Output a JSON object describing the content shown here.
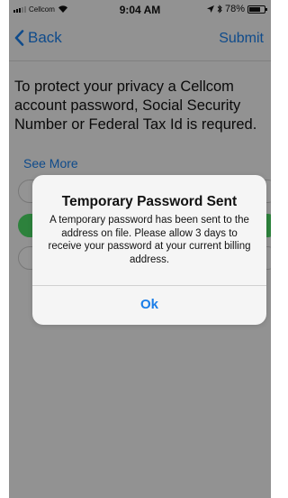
{
  "status_bar": {
    "carrier": "Cellcom",
    "time": "9:04 AM",
    "battery_pct": "78%",
    "icons": [
      "signal-icon",
      "wifi-icon",
      "location-arrow-icon",
      "bluetooth-icon",
      "battery-icon"
    ],
    "battery_level": 0.78
  },
  "nav": {
    "back_label": "Back",
    "submit_label": "Submit"
  },
  "content": {
    "message": "To protect your privacy a Cellcom account password, Social Security Number or Federal Tax Id is requred.",
    "see_more": "See More"
  },
  "alert": {
    "title": "Temporary Password Sent",
    "message": "A temporary password has been sent to the address on file. Please allow 3 days to receive your password at your current billing address.",
    "ok_label": "Ok"
  },
  "colors": {
    "accent": "#1a7ee8",
    "selected": "#4cd964"
  }
}
